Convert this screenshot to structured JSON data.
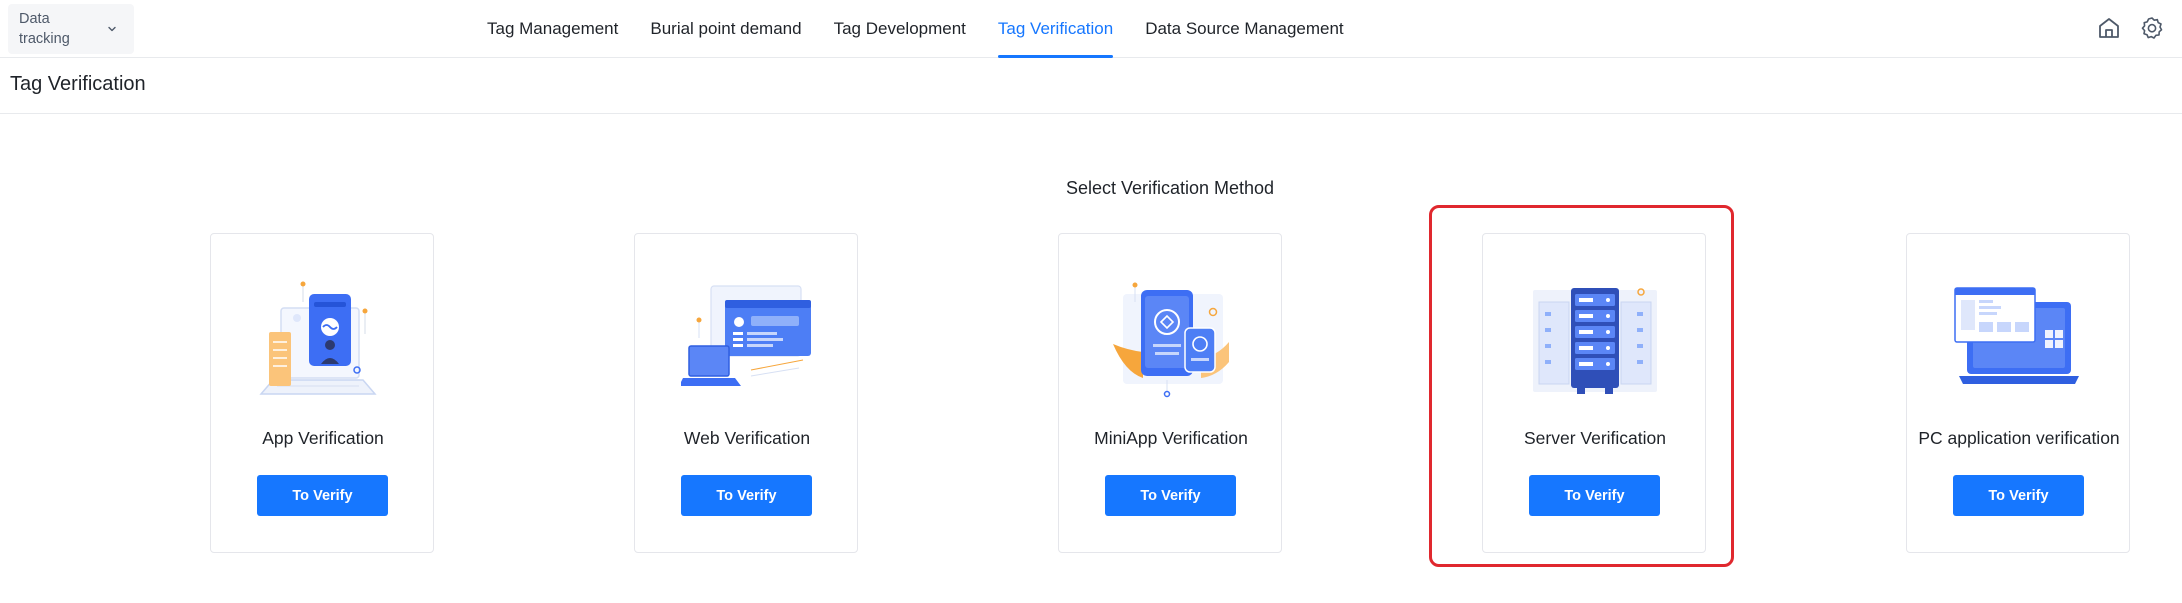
{
  "project_selector": {
    "label": "Data tracking"
  },
  "nav": {
    "items": [
      {
        "label": "Tag Management",
        "active": false
      },
      {
        "label": "Burial point demand",
        "active": false
      },
      {
        "label": "Tag Development",
        "active": false
      },
      {
        "label": "Tag Verification",
        "active": true
      },
      {
        "label": "Data Source Management",
        "active": false
      }
    ]
  },
  "header_icons": [
    "home-icon",
    "gear-icon"
  ],
  "page": {
    "title": "Tag Verification"
  },
  "main": {
    "section_title": "Select Verification Method",
    "cards": [
      {
        "title": "App Verification",
        "button": "To Verify",
        "icon": "app-illustration-icon"
      },
      {
        "title": "Web Verification",
        "button": "To Verify",
        "icon": "web-illustration-icon"
      },
      {
        "title": "MiniApp Verification",
        "button": "To Verify",
        "icon": "miniapp-illustration-icon"
      },
      {
        "title": "Server Verification",
        "button": "To Verify",
        "icon": "server-illustration-icon",
        "highlighted": true
      },
      {
        "title": "PC application verification",
        "button": "To Verify",
        "icon": "pc-illustration-icon"
      }
    ]
  },
  "colors": {
    "primary": "#1677ff",
    "highlight": "#e0282e",
    "border": "#e5e6eb",
    "text": "#1f2329"
  }
}
